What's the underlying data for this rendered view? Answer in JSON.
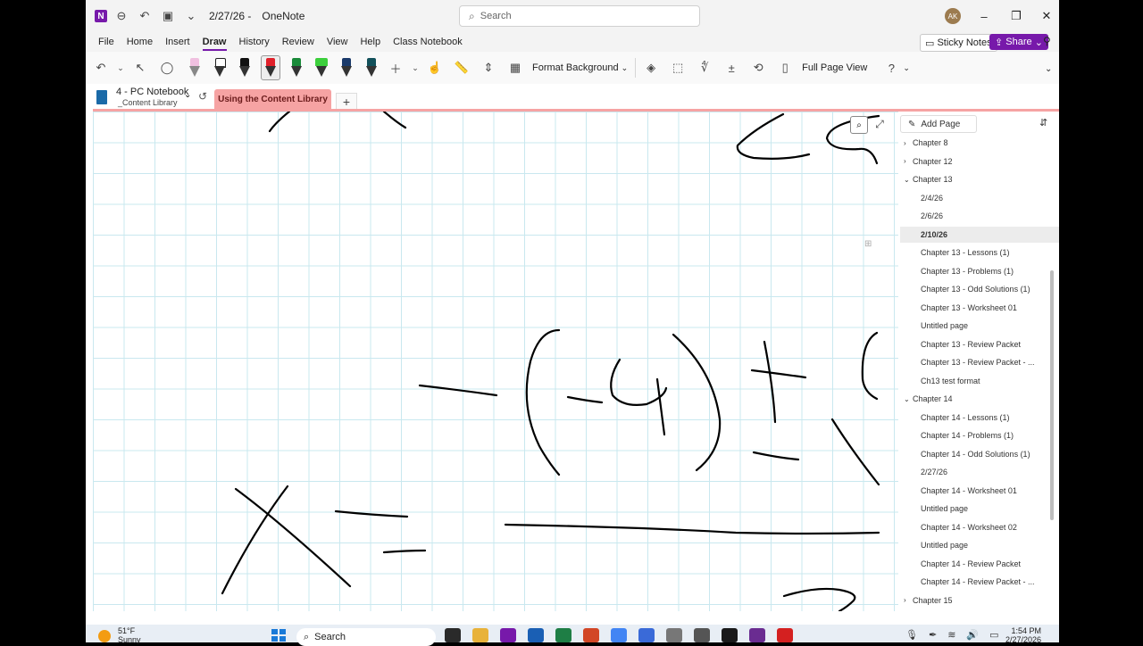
{
  "titlebar": {
    "logo_letter": "N",
    "date": "2/27/26",
    "app_name": "OneNote",
    "search_placeholder": "Search",
    "avatar_initials": "AK"
  },
  "menu": {
    "items": [
      "File",
      "Home",
      "Insert",
      "Draw",
      "History",
      "Review",
      "View",
      "Help",
      "Class Notebook"
    ],
    "active": "Draw",
    "sticky_notes": "Sticky Notes",
    "share": "Share"
  },
  "toolbar": {
    "format_background": "Format Background",
    "full_page_view": "Full Page View",
    "pen_colors": [
      "#f0c0e0",
      "#222222",
      "#111111",
      "#e0202a",
      "#1a8a3a",
      "#3ccf3c",
      "#1a3a6a",
      "#12505a"
    ]
  },
  "notebook": {
    "name": "4 - PC Notebook",
    "section_group": "_Content Library",
    "active_section": "Using the Content Library",
    "add_section": "+"
  },
  "pages_panel": {
    "add_page": "Add Page",
    "items": [
      {
        "label": "Chapter 8",
        "kind": "section",
        "state": "collapsed"
      },
      {
        "label": "Chapter 12",
        "kind": "section",
        "state": "collapsed"
      },
      {
        "label": "Chapter 13",
        "kind": "section",
        "state": "expanded"
      },
      {
        "label": "2/4/26",
        "kind": "page"
      },
      {
        "label": "2/6/26",
        "kind": "page"
      },
      {
        "label": "2/10/26",
        "kind": "page",
        "selected": true
      },
      {
        "label": "Chapter 13 - Lessons (1)",
        "kind": "page"
      },
      {
        "label": "Chapter 13 - Problems (1)",
        "kind": "page"
      },
      {
        "label": "Chapter 13 - Odd Solutions (1)",
        "kind": "page"
      },
      {
        "label": "Chapter 13 - Worksheet 01",
        "kind": "page"
      },
      {
        "label": "Untitled page",
        "kind": "page"
      },
      {
        "label": "Chapter 13 - Review Packet",
        "kind": "page"
      },
      {
        "label": "Chapter 13 - Review Packet - ...",
        "kind": "page"
      },
      {
        "label": "Ch13 test format",
        "kind": "page"
      },
      {
        "label": "Chapter 14",
        "kind": "section",
        "state": "expanded"
      },
      {
        "label": "Chapter 14 - Lessons (1)",
        "kind": "page"
      },
      {
        "label": "Chapter 14 - Problems (1)",
        "kind": "page"
      },
      {
        "label": "Chapter 14 - Odd Solutions (1)",
        "kind": "page"
      },
      {
        "label": "2/27/26",
        "kind": "page"
      },
      {
        "label": "Chapter 14 - Worksheet 01",
        "kind": "page"
      },
      {
        "label": "Untitled page",
        "kind": "page"
      },
      {
        "label": "Chapter 14 - Worksheet 02",
        "kind": "page"
      },
      {
        "label": "Untitled page",
        "kind": "page"
      },
      {
        "label": "Chapter 14 - Review Packet",
        "kind": "page"
      },
      {
        "label": "Chapter 14 - Review Packet - ...",
        "kind": "page"
      },
      {
        "label": "Chapter 15",
        "kind": "section",
        "state": "collapsed"
      }
    ]
  },
  "taskbar": {
    "temperature": "51°F",
    "condition": "Sunny",
    "search": "Search",
    "time": "1:54 PM",
    "date": "2/27/2026",
    "app_colors": [
      "#2a2a2a",
      "#e8b23a",
      "#7719aa",
      "#1a5fb4",
      "#1e7e45",
      "#d24726",
      "#4285f4",
      "#3a6ad8",
      "#777777",
      "#555555",
      "#1a1a1a",
      "#6a2c91",
      "#d42020"
    ]
  }
}
